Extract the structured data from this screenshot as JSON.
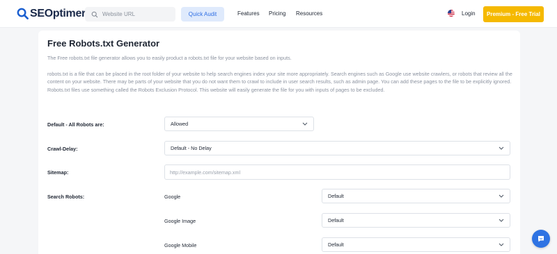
{
  "header": {
    "logo_text": "SEOptimer",
    "search_placeholder": "Website URL",
    "quick_audit_label": "Quick Audit",
    "menu": [
      "Features",
      "Pricing",
      "Resources"
    ],
    "login_label": "Login",
    "premium_label": "Premium - Free Trial"
  },
  "main": {
    "title": "Free Robots.txt Generator",
    "intro": "The Free robots.txt file generator allows you to easily product a robots.txt file for your website based on inputs.",
    "description": "robots.txt is a file that can be placed in the root folder of your website to help search engines index your site more appropriately. Search engines such as Google use website crawlers, or robots that review all the content on your website. There may be parts of your website that you do not want them to crawl to include in user search results, such as admin page. You can add these pages to the file to be explicitly ignored. Robots.txt files use something called the Robots Exclusion Protocol. This website will easily generate the file for you with inputs of pages to be excluded."
  },
  "form": {
    "default_robots": {
      "label": "Default - All Robots are:",
      "value": "Allowed"
    },
    "crawl_delay": {
      "label": "Crawl-Delay:",
      "value": "Default - No Delay"
    },
    "sitemap": {
      "label": "Sitemap:",
      "value": "",
      "placeholder": "http://example.com/sitemap.xml"
    },
    "search_robots": {
      "label": "Search Robots:",
      "items": [
        {
          "name": "Google",
          "value": "Default"
        },
        {
          "name": "Google Image",
          "value": "Default"
        },
        {
          "name": "Google Mobile",
          "value": "Default"
        }
      ]
    }
  },
  "colors": {
    "accent_blue": "#2f6fe4",
    "premium_yellow": "#f5b900",
    "chat_blue": "#2e73e3"
  },
  "icons": [
    "seoptimer-logo",
    "search-icon",
    "us-flag-icon",
    "chevron-down-icon",
    "chat-icon"
  ]
}
